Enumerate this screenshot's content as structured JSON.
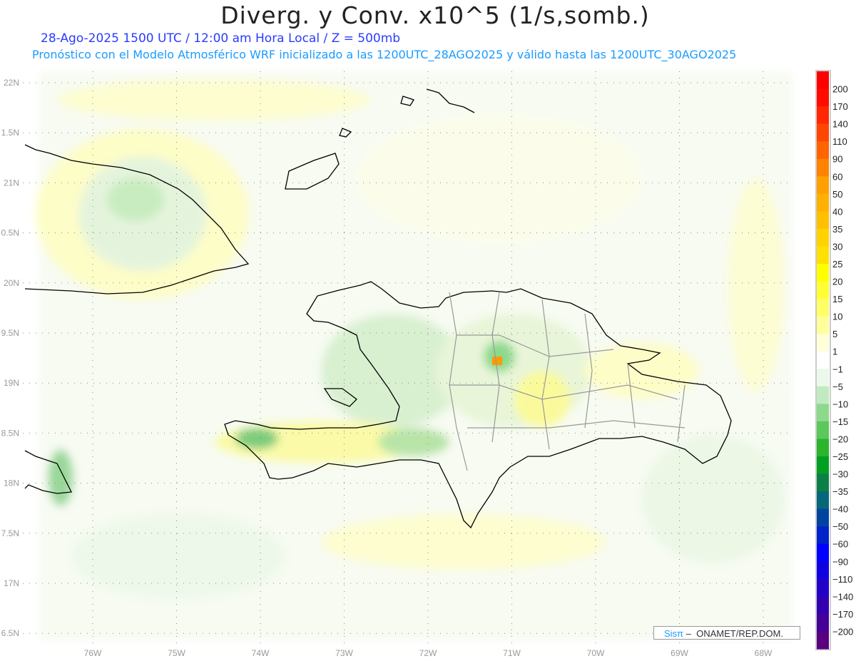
{
  "header": {
    "title": "Diverg. y Conv. x10^5 (1/s,somb.)",
    "line1": "28-Ago-2025  1500 UTC / 12:00 am Hora Local / Z = 500mb",
    "line2": "Pronóstico con el Modelo Atmosférico WRF inicializado a las 1200UTC_28AGO2025 y válido hasta las  1200UTC_30AGO2025"
  },
  "map": {
    "lat_labels": [
      "22N",
      "1.5N",
      "21N",
      "0.5N",
      "20N",
      "9.5N",
      "19N",
      "8.5N",
      "18N",
      "7.5N",
      "17N",
      "6.5N"
    ],
    "lon_labels": [
      "76W",
      "75W",
      "74W",
      "73W",
      "72W",
      "71W",
      "70W",
      "69W",
      "68W"
    ]
  },
  "colorbar": {
    "labels": [
      "200",
      "170",
      "140",
      "110",
      "90",
      "60",
      "50",
      "40",
      "35",
      "30",
      "25",
      "20",
      "15",
      "10",
      "5",
      "1",
      "−1",
      "−5",
      "−10",
      "−15",
      "−20",
      "−25",
      "−30",
      "−35",
      "−40",
      "−50",
      "−60",
      "−90",
      "−110",
      "−140",
      "−170",
      "−200"
    ],
    "colors": [
      "#ff0000",
      "#ff0c00",
      "#ff2800",
      "#ff4600",
      "#ff6400",
      "#ff8200",
      "#ffa000",
      "#ffb000",
      "#ffc000",
      "#ffd200",
      "#ffe000",
      "#ffff00",
      "#ffff33",
      "#ffff66",
      "#ffff99",
      "#ffffd8",
      "#ffffff",
      "#ecf8ec",
      "#c0ebc0",
      "#8cd98c",
      "#5ac85a",
      "#2cb42c",
      "#00a020",
      "#0a8048",
      "#046878",
      "#0044a0",
      "#0022c8",
      "#0000ff",
      "#1000e0",
      "#2200c8",
      "#3200b0",
      "#440098",
      "#580080"
    ]
  },
  "credit": {
    "brand": "Sisπ",
    "text": " –  ONAMET/REP.DOM."
  }
}
